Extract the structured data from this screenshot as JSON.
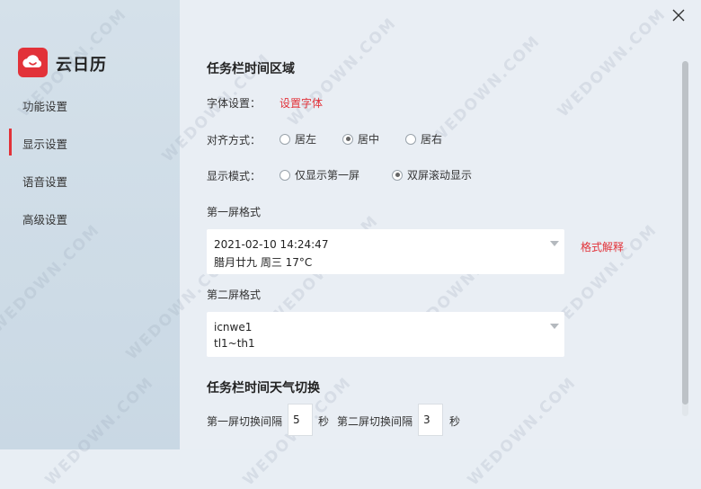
{
  "app": {
    "name": "云日历"
  },
  "nav": [
    {
      "label": "功能设置",
      "active": false
    },
    {
      "label": "显示设置",
      "active": true
    },
    {
      "label": "语音设置",
      "active": false
    },
    {
      "label": "高级设置",
      "active": false
    }
  ],
  "taskbar_time": {
    "title": "任务栏时间区域",
    "font": {
      "label": "字体设置：",
      "link": "设置字体"
    },
    "align": {
      "label": "对齐方式：",
      "options": [
        "居左",
        "居中",
        "居右"
      ],
      "selected": "居中"
    },
    "display_mode": {
      "label": "显示模式：",
      "options": [
        "仅显示第一屏",
        "双屏滚动显示"
      ],
      "selected": "双屏滚动显示"
    },
    "screen1": {
      "label": "第一屏格式",
      "line1": "2021-02-10 14:24:47",
      "line2": "腊月廿九 周三 17°C",
      "help_link": "格式解释"
    },
    "screen2": {
      "label": "第二屏格式",
      "line1": "icnwe1",
      "line2": "tl1~th1"
    }
  },
  "weather_switch": {
    "title": "任务栏时间天气切换",
    "screen1_interval_label": "第一屏切换间隔",
    "screen1_interval": "5",
    "unit1": "秒",
    "screen2_interval_label": "第二屏切换间隔",
    "screen2_interval": "3",
    "unit2": "秒"
  },
  "watermark": "WEDOWN.COM",
  "colors": {
    "accent": "#e23239",
    "sidebar_bg": "#cfdce7",
    "main_bg": "#e9eef4"
  }
}
